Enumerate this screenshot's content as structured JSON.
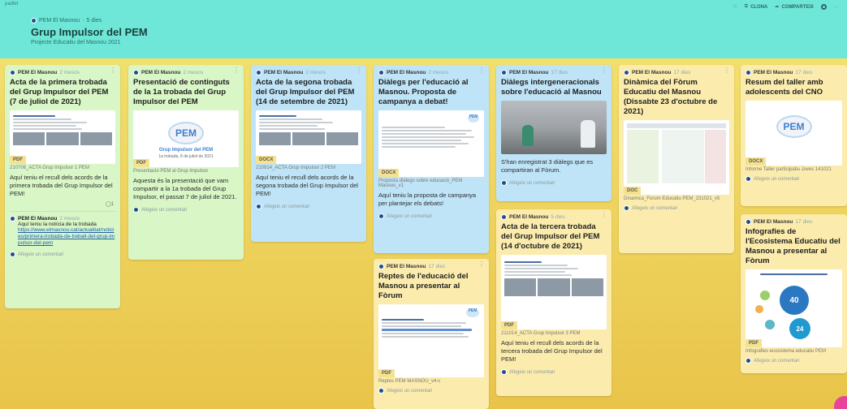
{
  "top": {
    "tiny_left": "padlet",
    "author": "PEM El Masnou",
    "author_time": "5 dies",
    "title": "Grup Impulsor del PEM",
    "subtitle": "Projecte Educatiu del Masnou 2021",
    "actions": [
      "CLONA",
      "COMPARTEIX"
    ]
  },
  "comment_label": "Afegeix un comentari",
  "cards": {
    "c1": {
      "author": "PEM El Masnou",
      "time": "2 mesos",
      "title": "Acta de la primera trobada del Grup Impulsor del PEM (7 de juliol de 2021)",
      "badge": "PDF",
      "file": "210706_ACTA Grup Impulsor 1 PEM",
      "body": "Aquí teniu el recull dels acords de la primera trobada del Grup Impulsor del PEM!",
      "count": "1",
      "reply_author": "PEM El Masnou",
      "reply_time": "2 mesos",
      "reply_text": "Aquí teniu la notícia de la trobada",
      "reply_link": "https://www.elmasnou.cat/actualitat/noticies/primera-trobada-de-treball-del-grup-impulsor-del-pem"
    },
    "c2": {
      "author": "PEM El Masnou",
      "time": "2 mesos",
      "title": "Presentació de continguts de la 1a trobada del Grup Impulsor del PEM",
      "badge": "PDF",
      "file": "Presentació PEM al Grup Impulsor",
      "thumb_text": "Grup Impulsor del PEM",
      "thumb_sub": "1a trobada, 8 de juliol de 2021",
      "body": "Aquesta és la presentació que vam compartir a la 1a trobada del Grup Impulsor, el passat 7 de juliol de 2021."
    },
    "c3": {
      "author": "PEM El Masnou",
      "time": "2 mesos",
      "title": "Acta de la segona trobada del Grup Impulsor del PEM (14 de setembre de 2021)",
      "badge": "DOCX",
      "file": "210914_ACTA Grup Impulsor 2 PEM",
      "body": "Aquí teniu el recull dels acords de la segona trobada del Grup Impulsor del PEM!"
    },
    "c4": {
      "author": "PEM El Masnou",
      "time": "2 mesos",
      "title": "Diàlegs per l'educació al Masnou. Proposta de campanya a debat!",
      "badge": "DOCX",
      "file": "Proposta diàlegs sobre educació_PEM Masnou_v1",
      "body": "Aquí teniu la proposta de campanya per plantejar els debats!"
    },
    "c5": {
      "author": "PEM El Masnou",
      "time": "17 dies",
      "title": "Reptes de l'educació del Masnou a presentar al Fòrum",
      "badge": "PDF",
      "file": "Reptes PEM MASNOU_v4-c"
    },
    "c6": {
      "author": "PEM El Masnou",
      "time": "17 dies",
      "title": "Diàlegs intergeneracionals sobre l'educació al Masnou",
      "body": "S'han enregistrat 3 diàlegs que es compartiran al Fòrum."
    },
    "c7": {
      "author": "PEM El Masnou",
      "time": "5 dies",
      "title": "Acta de la tercera trobada del Grup Impulsor del PEM (14 d'octubre de 2021)",
      "badge": "PDF",
      "file": "211014_ACTA Grup Impulsor 3 PEM",
      "body": "Aquí teniu el recull dels acords de la tercera trobada del Grup Impulsor del PEM!"
    },
    "c8": {
      "author": "PEM El Masnou",
      "time": "17 dies",
      "title": "Dinàmica del Fòrum Educatiu del Masnou (Dissabte 23 d'octubre de 2021)",
      "badge": "DOC",
      "file": "Dinamica_Forum Educatiu PEM_231021_v5"
    },
    "c9": {
      "author": "PEM El Masnou",
      "time": "17 dies",
      "title": "Resum del taller amb adolescents del CNO",
      "badge": "DOCX",
      "file": "Informe Taller participatiu Joves 141021"
    },
    "c10": {
      "author": "PEM El Masnou",
      "time": "17 dies",
      "title": "Infografies de l'Ecosistema Educatiu del Masnou a presentar al Fòrum",
      "badge": "PDF",
      "file": "Infografies ecosistema educatiu PEM",
      "info_num1": "40",
      "info_num2": "24"
    }
  },
  "colors": {
    "header": "#6ee7d8",
    "green": "#d8f6c6",
    "blue": "#bfe4f7",
    "yellow": "#fbecad",
    "fab": "#e8449a"
  }
}
